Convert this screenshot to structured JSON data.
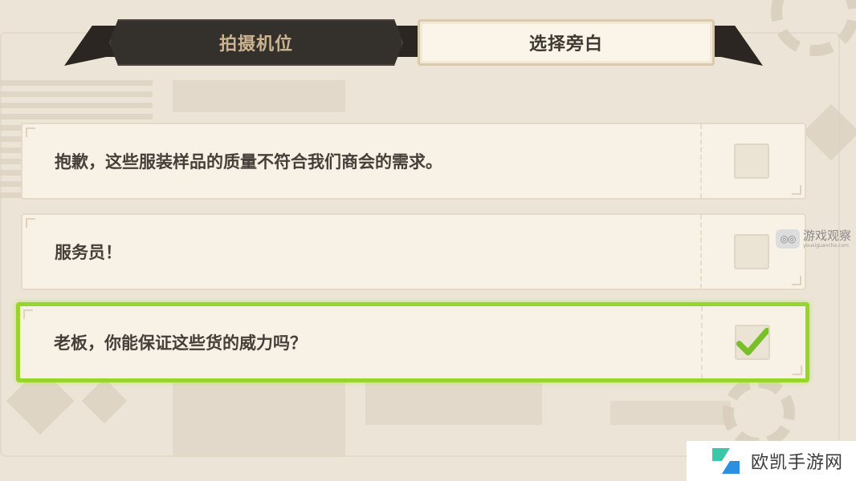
{
  "tabs": [
    {
      "label": "拍摄机位",
      "active": false
    },
    {
      "label": "选择旁白",
      "active": true
    }
  ],
  "options": [
    {
      "text": "抱歉，这些服装样品的质量不符合我们商会的需求。",
      "checked": false
    },
    {
      "text": "服务员！",
      "checked": false
    },
    {
      "text": "老板，你能保证这些货的威力吗？",
      "checked": true
    }
  ],
  "watermarks": {
    "side_main": "游戏观察",
    "side_sub": "youxiguancha.com",
    "bottom": "欧凯手游网"
  },
  "colors": {
    "selected_border": "#97d42c",
    "check_mark": "#78bf2a",
    "tab_dark": "#34302b",
    "tab_light": "#fbf4e8"
  },
  "icons": {
    "check": "check-icon",
    "side_logo": "eyes-logo-icon",
    "bottom_logo": "ok-logo-icon"
  }
}
